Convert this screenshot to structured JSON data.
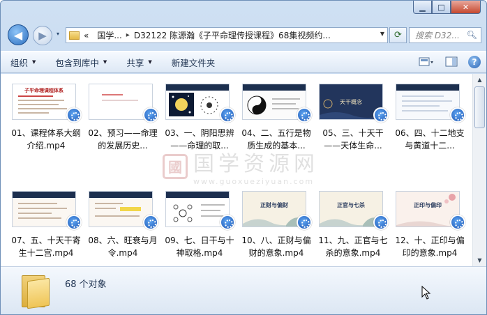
{
  "window": {
    "caption": {
      "minimize": "▁",
      "maximize": "□",
      "close": "✕"
    }
  },
  "nav": {
    "back_icon": "◀",
    "forward_icon": "▶",
    "dropdown_icon": "▾",
    "breadcrumb": [
      "«",
      "国学...",
      "D32122 陈源瀚《子平命理传授课程》68集视频约..."
    ],
    "refresh_icon": "⟳",
    "search_placeholder": "搜索 D32..."
  },
  "toolbar": {
    "organize": "组织",
    "include_in_library": "包含到库中",
    "share": "共享",
    "new_folder": "新建文件夹",
    "dropdown_arrow": "▼"
  },
  "files": [
    {
      "name": "01、课程体系大纲介绍.mp4",
      "thumb_style": "doc",
      "thumb_title": "子平命理课程体系"
    },
    {
      "name": "02、预习——命理的发展历史...",
      "thumb_style": "blank",
      "thumb_title": ""
    },
    {
      "name": "03、一、阴阳思辨——命理的取...",
      "thumb_style": "dark-stars",
      "thumb_title": ""
    },
    {
      "name": "04、二、五行是物质生成的基本...",
      "thumb_style": "yinyang",
      "thumb_title": ""
    },
    {
      "name": "05、三、十天干——天体生命...",
      "thumb_style": "navy",
      "thumb_title": "天干概念"
    },
    {
      "name": "06、四、十二地支与黄道十二...",
      "thumb_style": "doc-blue",
      "thumb_title": ""
    },
    {
      "name": "07、五、十天干寄生十二宫.mp4",
      "thumb_style": "doc-blue",
      "thumb_title": ""
    },
    {
      "name": "08、六、旺衰与月令.mp4",
      "thumb_style": "doc-yellow",
      "thumb_title": ""
    },
    {
      "name": "09、七、日干与十神取格.mp4",
      "thumb_style": "circles",
      "thumb_title": ""
    },
    {
      "name": "10、八、正财与偏财的意象.mp4",
      "thumb_style": "landscape",
      "thumb_title": "正财与偏财"
    },
    {
      "name": "11、九、正官与七杀的意象.mp4",
      "thumb_style": "landscape",
      "thumb_title": "正官与七杀"
    },
    {
      "name": "12、十、正印与偏印的意象.mp4",
      "thumb_style": "landscape-pink",
      "thumb_title": "正印与偏印"
    }
  ],
  "watermark": {
    "seal": "國",
    "big": "国学资源网",
    "url": "www.guoxueziyuan.com"
  },
  "status": {
    "count": "68 个对象"
  },
  "colors": {
    "accent": "#2e66b5",
    "toolbar_bg": "#dde8f5",
    "status_bg": "#dbe6f3"
  }
}
